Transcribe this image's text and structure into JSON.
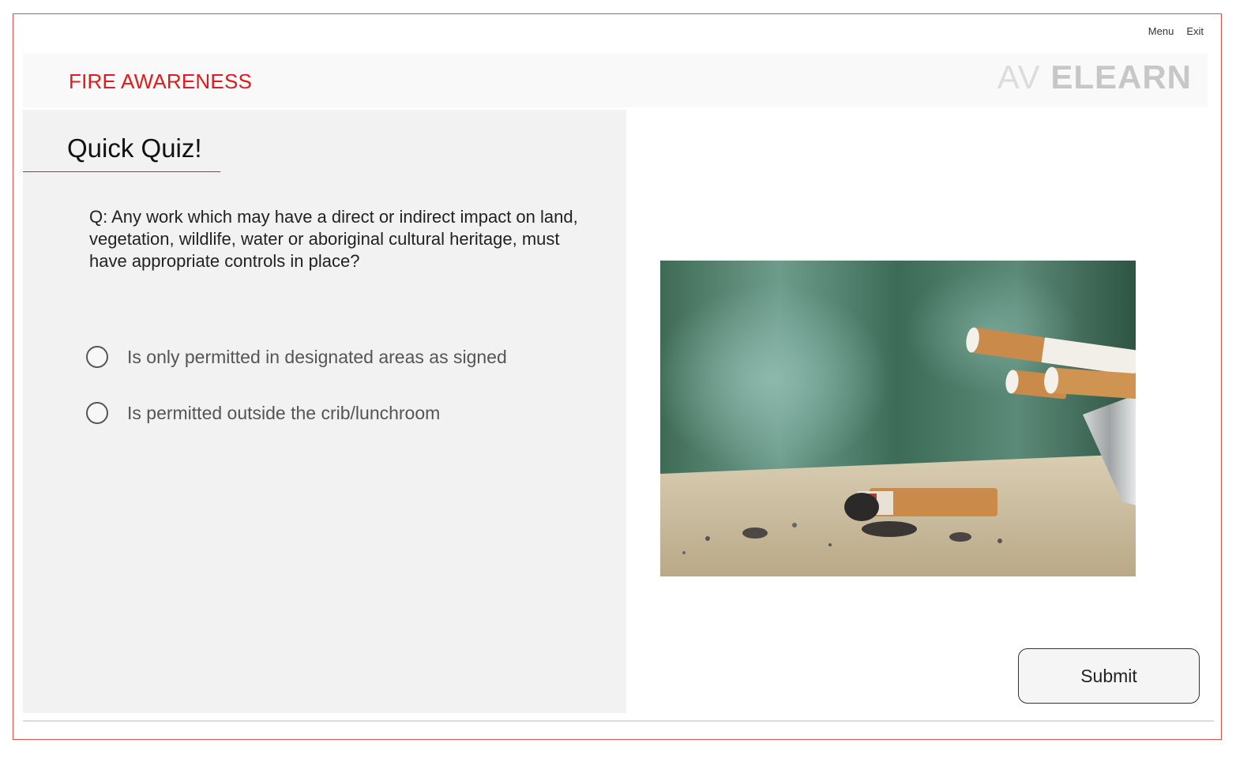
{
  "nav": {
    "menu_label": "Menu",
    "exit_label": "Exit"
  },
  "header": {
    "course_title": "FIRE AWARENESS",
    "logo_light": "AV",
    "logo_bold": "ELEARN"
  },
  "quiz": {
    "heading": "Quick Quiz!",
    "question": "Q: Any work which may have a direct or indirect impact on land, vegetation, wildlife, water or aboriginal cultural heritage, must have appropriate controls in place?",
    "options": [
      {
        "label": "Is only permitted in designated areas as signed"
      },
      {
        "label": "Is permitted outside the crib/lunchroom"
      }
    ],
    "submit_label": "Submit"
  },
  "colors": {
    "accent": "#e21b1b",
    "panel_bg": "#f2f2f2",
    "header_bg": "#f9f9f9"
  },
  "image": {
    "icon": "cigarette-ashtray-photo"
  }
}
